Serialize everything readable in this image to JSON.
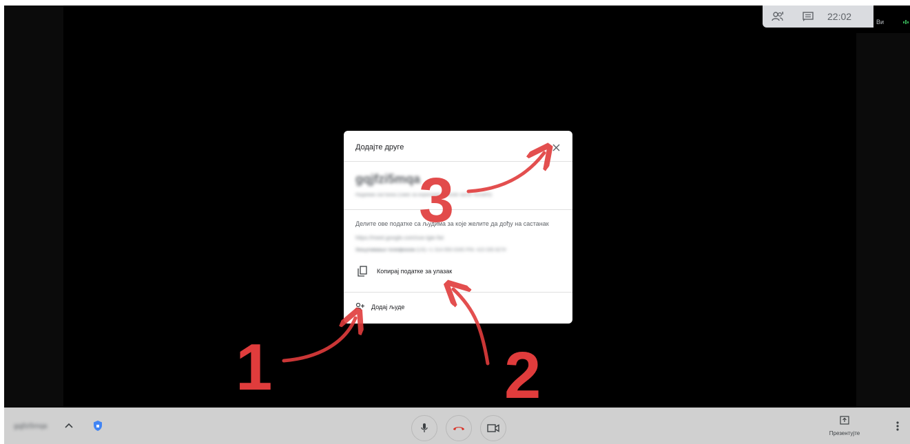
{
  "top_panel": {
    "time": "22:02",
    "you_label": "Ви"
  },
  "modal": {
    "title": "Додајте друге",
    "meeting_code": "gqjfzi5mqa",
    "meeting_subtitle": "Надимак састанка (само за кориснике G Suite налог Koraf/O)",
    "share_text": "Делите ове податке са људима за које желите да дођу на састанак",
    "link": "https://meet.google.com/xxe-tgie-fwi",
    "phone_label": "Укључивање телефоном",
    "phone_details": "(US) +1 314-550-0345 PIN: 415 035 827#",
    "copy_label": "Копирај податке за улазак",
    "add_people_label": "Додај људе"
  },
  "annotations": {
    "step1": "1",
    "step2": "2",
    "step3": "3",
    "color": "#e03c3c"
  },
  "bottom_bar": {
    "meeting_name": "gqjfzi5mqa",
    "present_label": "Презентујте"
  },
  "colors": {
    "stage_bg": "#000000",
    "bar_bg": "#d0d0d0",
    "end_call": "#d93025",
    "shield": "#4285f4"
  }
}
